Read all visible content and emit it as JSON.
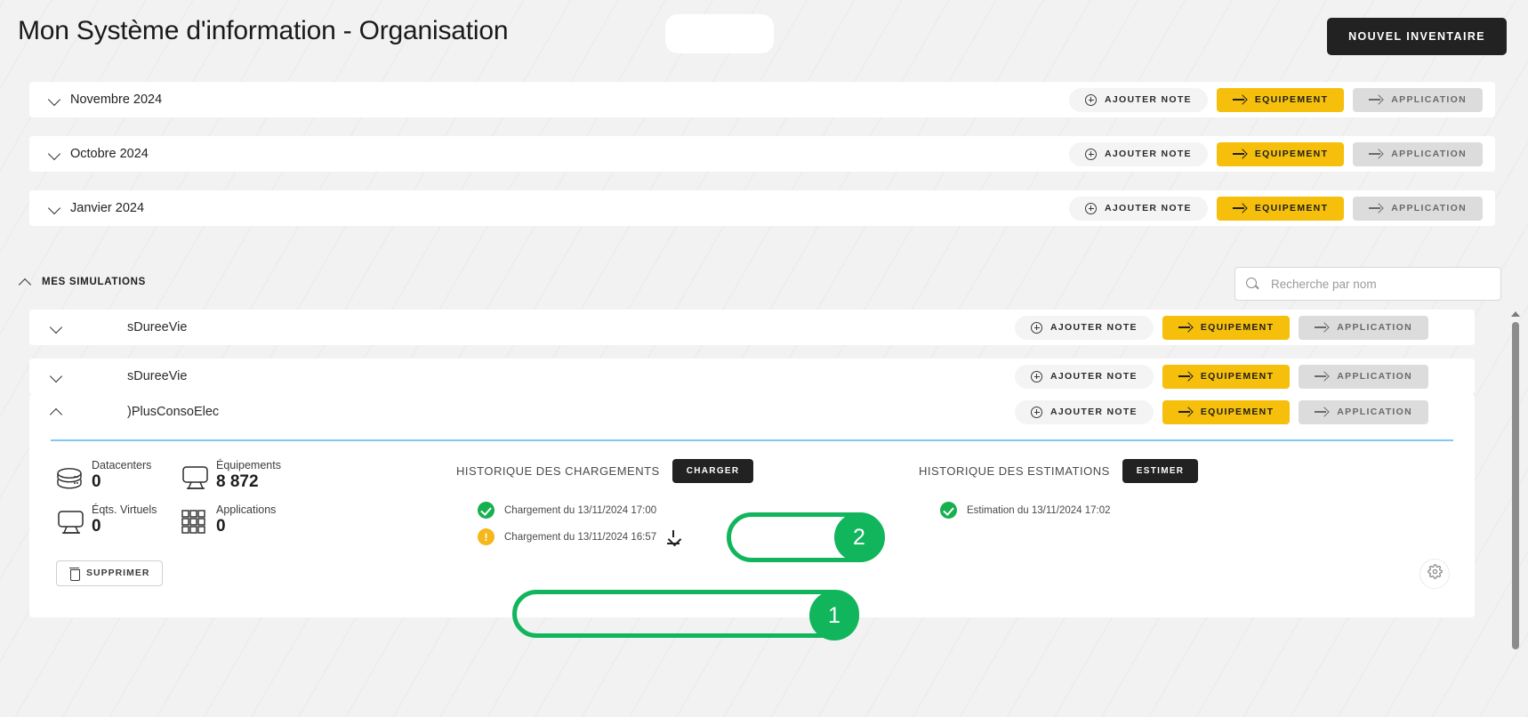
{
  "header": {
    "title": "Mon Système d'information - Organisation",
    "new_inventory_label": "NOUVEL INVENTAIRE"
  },
  "row_actions": {
    "add_note_label": "AJOUTER NOTE",
    "equipment_label": "EQUIPEMENT",
    "application_label": "APPLICATION"
  },
  "inventories": [
    {
      "label": "Novembre 2024"
    },
    {
      "label": "Octobre 2024"
    },
    {
      "label": "Janvier 2024"
    }
  ],
  "simulations_section": {
    "title": "MES SIMULATIONS",
    "search": {
      "placeholder": "Recherche par nom",
      "value": ""
    }
  },
  "simulations": [
    {
      "name": "sDureeVie",
      "expanded": false
    },
    {
      "name": "sDureeVie",
      "expanded": false
    },
    {
      "name": ")PlusConsoElec",
      "expanded": true
    }
  ],
  "detail": {
    "stats": [
      {
        "icon": "datacenter-icon",
        "label": "Datacenters",
        "value": "0"
      },
      {
        "icon": "equipment-icon",
        "label": "Équipements",
        "value": "8 872"
      },
      {
        "icon": "virtual-equipment-icon",
        "label": "Éqts. Virtuels",
        "value": "0"
      },
      {
        "icon": "applications-icon",
        "label": "Applications",
        "value": "0"
      }
    ],
    "delete_label": "SUPPRIMER",
    "loading_history": {
      "title": "HISTORIQUE DES CHARGEMENTS",
      "button_label": "CHARGER",
      "items": [
        {
          "status": "ok",
          "label": "Chargement du 13/11/2024 17:00",
          "download": false
        },
        {
          "status": "warn",
          "label": "Chargement du 13/11/2024 16:57",
          "download": true
        }
      ]
    },
    "estimation_history": {
      "title": "HISTORIQUE DES ESTIMATIONS",
      "button_label": "ESTIMER",
      "items": [
        {
          "status": "ok",
          "label": "Estimation du 13/11/2024 17:02"
        }
      ]
    },
    "settings_icon": "gear-icon"
  },
  "annotations": [
    {
      "id": "1",
      "label": "1"
    },
    {
      "id": "2",
      "label": "2"
    }
  ],
  "colors": {
    "accent_yellow": "#f5bf0b",
    "dark": "#222222",
    "annotation_green": "#11b55c",
    "status_ok": "#17b04e",
    "status_warn": "#f5b81c",
    "divider_blue": "#7ec8f2"
  }
}
